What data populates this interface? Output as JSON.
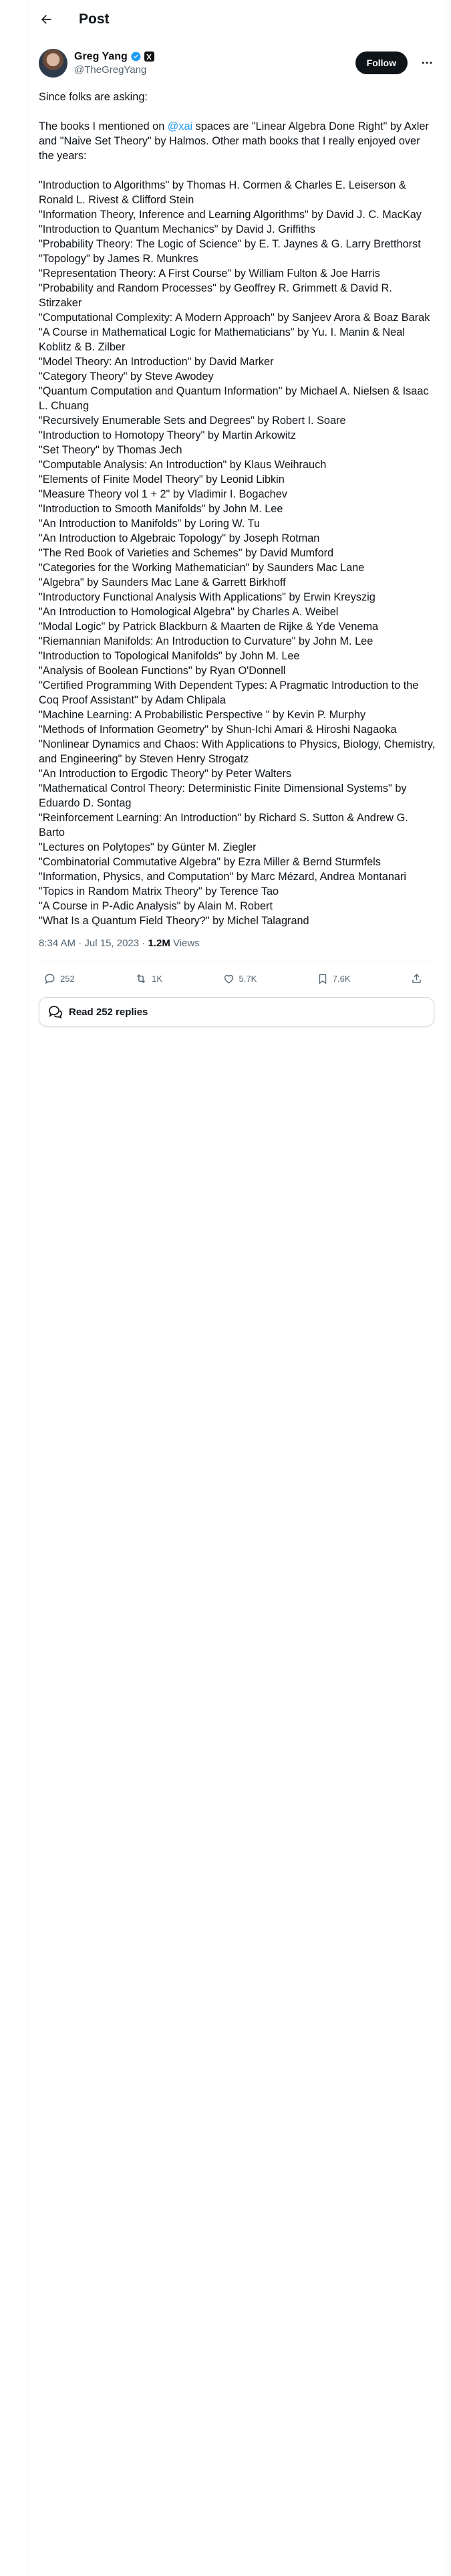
{
  "topbar": {
    "title": "Post"
  },
  "author": {
    "name": "Greg Yang",
    "handle": "@TheGregYang"
  },
  "follow_label": "Follow",
  "tweet": {
    "intro": "Since folks are asking:",
    "p2_before": "The books I mentioned on ",
    "p2_mention": "@xai",
    "p2_after": " spaces are \"Linear Algebra Done Right\" by Axler and \"Naive Set Theory\" by Halmos. Other math books that I really enjoyed over the years:",
    "books": [
      "\"Introduction to Algorithms\" by Thomas H. Cormen & Charles E. Leiserson & Ronald L. Rivest & Clifford Stein",
      "\"Information Theory, Inference and Learning Algorithms\" by David J. C. MacKay",
      "\"Introduction to Quantum Mechanics\" by David J. Griffiths",
      "\"Probability Theory: The Logic of Science\" by E. T. Jaynes & G. Larry Bretthorst",
      "\"Topology\" by James R. Munkres",
      "\"Representation Theory: A First Course\" by William Fulton & Joe Harris",
      "\"Probability and Random Processes\" by Geoffrey R. Grimmett & David R. Stirzaker",
      "\"Computational Complexity: A Modern Approach\" by Sanjeev Arora & Boaz Barak",
      "\"A Course in Mathematical Logic for Mathematicians\" by Yu. I. Manin & Neal Koblitz & B. Zilber",
      "\"Model Theory: An Introduction\" by David Marker",
      "\"Category Theory\" by Steve Awodey",
      "\"Quantum Computation and Quantum Information\" by Michael A. Nielsen & Isaac L. Chuang",
      "\"Recursively Enumerable Sets and Degrees\" by Robert I. Soare",
      "\"Introduction to Homotopy Theory\" by Martin Arkowitz",
      "\"Set Theory\" by Thomas Jech",
      "\"Computable Analysis: An Introduction\" by Klaus Weihrauch",
      "\"Elements of Finite Model Theory\" by Leonid Libkin",
      "\"Measure Theory vol 1 + 2\" by Vladimir I. Bogachev",
      "\"Introduction to Smooth Manifolds\" by John M. Lee",
      "\"An Introduction to Manifolds\" by Loring W. Tu",
      "\"An Introduction to Algebraic Topology\" by Joseph Rotman",
      "\"The Red Book of Varieties and Schemes\" by David Mumford",
      "\"Categories for the Working Mathematician\" by Saunders Mac Lane",
      "\"Algebra\" by Saunders Mac Lane & Garrett Birkhoff",
      "\"Introductory Functional Analysis With Applications\" by Erwin Kreyszig",
      "\"An Introduction to Homological Algebra\" by Charles A. Weibel",
      "\"Modal Logic\" by Patrick Blackburn & Maarten de Rijke & Yde Venema",
      "\"Riemannian Manifolds: An Introduction to Curvature\" by John M. Lee",
      "\"Introduction to Topological Manifolds\" by John M. Lee",
      "\"Analysis of Boolean Functions\" by Ryan O'Donnell",
      "\"Certified Programming With Dependent Types: A Pragmatic Introduction to the Coq Proof Assistant\" by Adam Chlipala",
      "\"Machine Learning: A Probabilistic Perspective \" by Kevin P. Murphy",
      "\"Methods of Information Geometry\" by Shun-Ichi Amari & Hiroshi Nagaoka",
      "\"Nonlinear Dynamics and Chaos: With Applications to Physics, Biology, Chemistry, and Engineering\" by Steven Henry Strogatz",
      "\"An Introduction to Ergodic Theory\" by Peter Walters",
      "\"Mathematical Control Theory: Deterministic Finite Dimensional Systems\" by Eduardo D. Sontag",
      "\"Reinforcement Learning: An Introduction\" by Richard S. Sutton & Andrew G. Barto",
      "\"Lectures on Polytopes\" by Günter M. Ziegler",
      "\"Combinatorial Commutative Algebra\" by Ezra Miller & Bernd Sturmfels",
      "\"Information, Physics, and Computation\" by Marc Mézard, Andrea Montanari",
      "\"Topics in Random Matrix Theory\" by Terence Tao",
      "\"A Course in P-Adic Analysis\" by Alain M. Robert",
      "\"What Is a Quantum Field Theory?\" by Michel Talagrand"
    ]
  },
  "meta": {
    "time": "8:34 AM",
    "sep1": " · ",
    "date": "Jul 15, 2023",
    "sep2": " · ",
    "views": "1.2M",
    "views_label": " Views"
  },
  "actions": {
    "replies": "252",
    "reposts": "1K",
    "likes": "5.7K",
    "bookmarks": "7.6K"
  },
  "read_replies": "Read 252 replies",
  "colors": {
    "accent": "#1d9bf0",
    "text": "#0f1419",
    "muted": "#536471"
  }
}
